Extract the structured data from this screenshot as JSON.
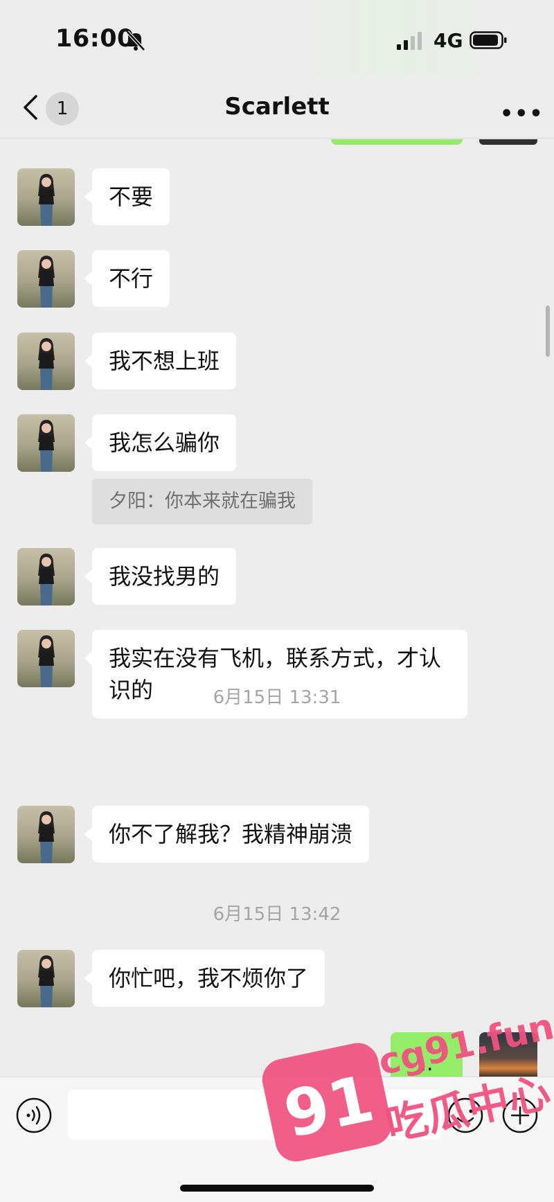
{
  "status_bar": {
    "time": "16:00",
    "network": "4G"
  },
  "nav": {
    "unread_count": "1",
    "contact_name": "Scarlett"
  },
  "messages": [
    {
      "text": "不要"
    },
    {
      "text": "不行"
    },
    {
      "text": "我不想上班"
    },
    {
      "text": "我怎么骗你",
      "quote": "夕阳：你本来就在骗我"
    },
    {
      "text": "我没找男的"
    },
    {
      "text": "我实在没有飞机，联系方式，才认识的"
    },
    {
      "text": "你不了解我？我精神崩溃"
    },
    {
      "text": "你忙吧，我不烦你了"
    }
  ],
  "timestamps": [
    "6月15日 13:31",
    "6月15日 13:42"
  ],
  "self_message": {
    "text": ".."
  },
  "watermark": {
    "number": "91",
    "domain": "cg91.fun",
    "slogan": "吃瓜中心"
  },
  "colors": {
    "self_bubble": "#95ec69",
    "peer_bubble": "#ffffff",
    "watermark": "#f0527f"
  },
  "icons": [
    "mute-bell-icon",
    "signal-icon",
    "battery-icon",
    "back-chevron-icon",
    "more-icon",
    "voice-icon",
    "emoji-icon",
    "plus-icon"
  ]
}
